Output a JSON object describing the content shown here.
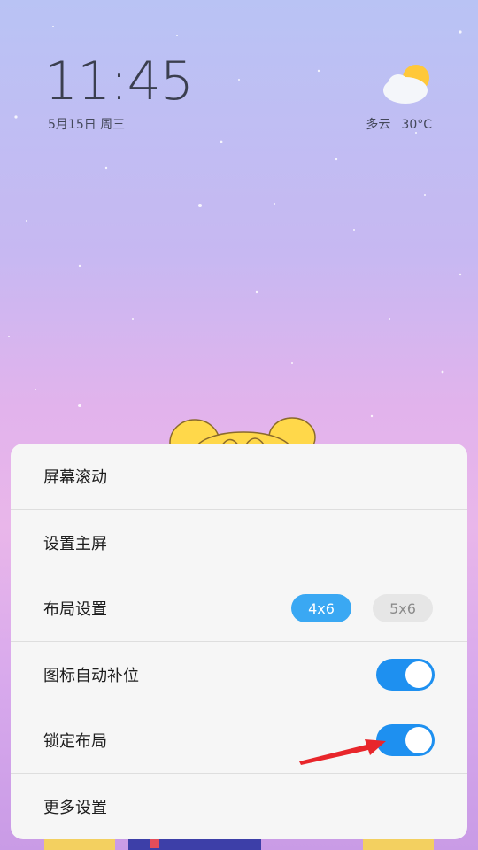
{
  "lockscreen": {
    "time": "11:45",
    "date": "5月15日 周三",
    "weather": {
      "condition": "多云",
      "temperature": "30°C",
      "icon": "partly-cloudy-icon"
    }
  },
  "menu": {
    "items": [
      {
        "label": "屏幕滚动"
      },
      {
        "label": "设置主屏"
      },
      {
        "label": "布局设置",
        "options": [
          "4x6",
          "5x6"
        ],
        "selected": "4x6"
      },
      {
        "label": "图标自动补位",
        "toggle": true
      },
      {
        "label": "锁定布局",
        "toggle": true
      },
      {
        "label": "更多设置"
      }
    ]
  },
  "colors": {
    "accent": "#3aa8f3",
    "toggle_on": "#1e90f0",
    "panel_bg": "#f6f6f6",
    "annotation_arrow": "#e8262b"
  }
}
